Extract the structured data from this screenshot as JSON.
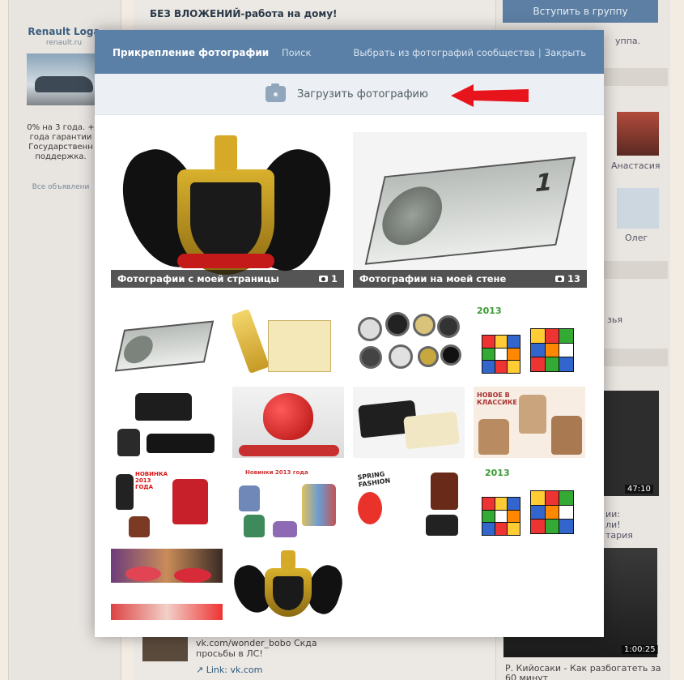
{
  "background": {
    "ad": {
      "title": "Renault Loga",
      "domain": "renault.ru",
      "text_lines": [
        "0% на 3 года. +",
        "года гарантии",
        "Государственн",
        "поддержка."
      ],
      "all_ads": "Все объявлени"
    },
    "feed_top_text": "БЕЗ ВЛОЖЕНИЙ-работа на дому!",
    "join_button": "Вступить в группу",
    "right_labels": {
      "group": "уппа.",
      "anastasia": "Анастасия",
      "oleg": "Олег",
      "friends": "зья",
      "video_a_lines": [
        "ии:",
        "ли!",
        "тария"
      ],
      "video_a_time": "47:10",
      "video_b_time": "1:00:25",
      "video_b_caption": "Р. Кийосаки - Как разбогатеть за",
      "video_b_caption_2": "60 минут"
    },
    "bottom_feed": {
      "line1": "vk.com/wonder_bobo Скда",
      "line2": "просьбы в ЛС!",
      "link": "Link: vk.com"
    }
  },
  "modal": {
    "title": "Прикрепление фотографии",
    "search": "Поиск",
    "community_link": "Выбрать из фотографий сообщества",
    "separator": "|",
    "close_link": "Закрыть",
    "upload_label": "Загрузить фотографию",
    "albums": [
      {
        "name": "Фотографии с моей страницы",
        "count": "1"
      },
      {
        "name": "Фотографии на моей стене",
        "count": "13"
      }
    ],
    "thumb_texts": {
      "year": "2013",
      "year2": "2013",
      "novinka": "НОВИНКА 2013 ГОДА",
      "novinka2": "Новинки 2013 года",
      "spring": "SPRING FASHION",
      "klassika": "НОВОЕ В КЛАССИКЕ"
    }
  },
  "colors": {
    "header_bg": "#5b80a8",
    "upload_bar": "#eceff3",
    "arrow": "#e8141c"
  }
}
